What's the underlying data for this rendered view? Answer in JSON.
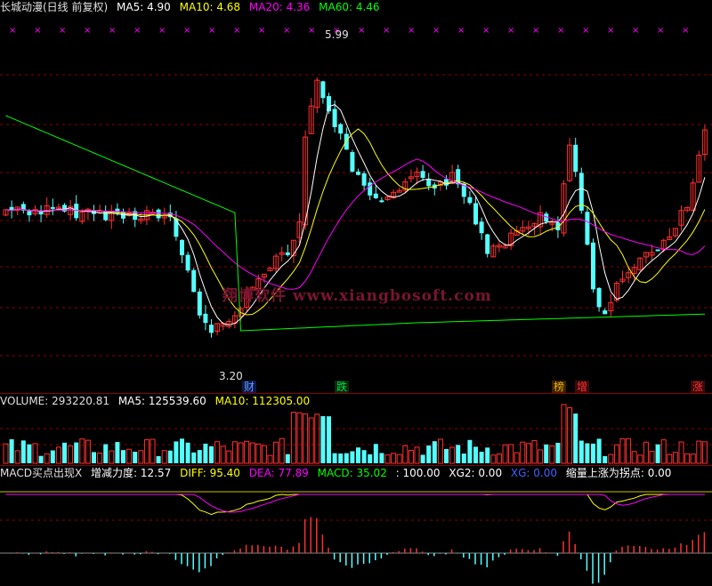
{
  "main_panel": {
    "name": "长城动漫(日线 前复权)",
    "ma5": "MA5: 4.90",
    "ma10": "MA10: 4.68",
    "ma20": "MA20: 4.36",
    "ma60": "MA60: 4.46",
    "high_label": "5.99",
    "low_label": "3.20",
    "watermark": "翔博软件 www.xiangbosoft.com",
    "markers": [
      {
        "text": "财",
        "color": "#5aa0ff",
        "bg": "#10184a"
      },
      {
        "text": "跌",
        "color": "#00e040",
        "bg": "#0a2a10"
      },
      {
        "text": "榜",
        "color": "#f0b000",
        "bg": "#3a2200"
      },
      {
        "text": "增",
        "color": "#ff3030",
        "bg": "#3a0a0a"
      },
      {
        "text": "涨",
        "color": "#ff3030",
        "bg": "#3a0a0a"
      }
    ]
  },
  "volume_panel": {
    "volume": "VOLUME: 293220.81",
    "ma5": "MA5: 125539.60",
    "ma10": "MA10: 112305.00"
  },
  "macd_panel": {
    "name": "MACD买点出现X",
    "force": "增减力度: 12.57",
    "diff": "DIFF: 95.40",
    "dea": "DEA: 77.89",
    "macd": "MACD: 35.02",
    "ratio": ": 100.00",
    "xg2": "XG2: 0.00",
    "xg": "XG: 0.00",
    "shrink": "缩量上涨为拐点: 0.00"
  },
  "colors": {
    "up": "#ff3030",
    "down": "#54ffff",
    "ma5": "#ffffff",
    "ma10": "#ffff00",
    "ma20": "#ff00ff",
    "ma60": "#00ff00",
    "grid": "#8b0000"
  }
}
